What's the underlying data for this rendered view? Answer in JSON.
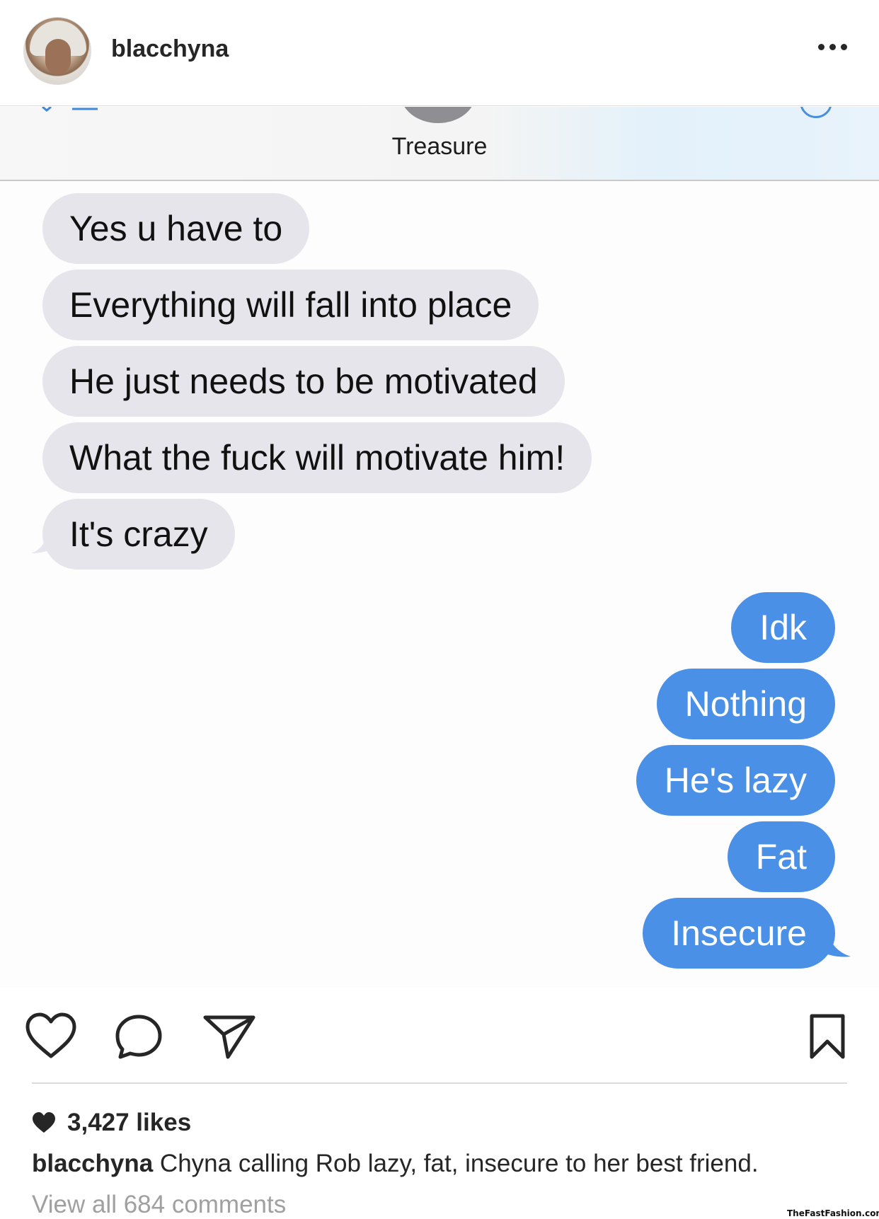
{
  "post": {
    "username": "blacchyna",
    "more_icon": "more-horizontal-icon"
  },
  "screenshot": {
    "contact_name": "Treasure",
    "incoming_messages": [
      "Yes u have to",
      "Everything will fall into place",
      "He just needs to be motivated",
      "What the fuck will motivate him!",
      "It's crazy"
    ],
    "outgoing_messages": [
      "Idk",
      "Nothing",
      "He's lazy",
      "Fat",
      "Insecure"
    ],
    "colors": {
      "incoming_bubble": "#e6e5eb",
      "outgoing_bubble": "#4a90e6"
    }
  },
  "actions": {
    "icons": [
      "heart-icon",
      "comment-icon",
      "share-icon",
      "bookmark-icon"
    ]
  },
  "likes": {
    "text": "3,427 likes"
  },
  "caption": {
    "username": "blacchyna",
    "text": " Chyna calling Rob lazy, fat, insecure to her best friend."
  },
  "comments": {
    "view_all": "View all 684 comments"
  },
  "watermark": "TheFastFashion.com"
}
